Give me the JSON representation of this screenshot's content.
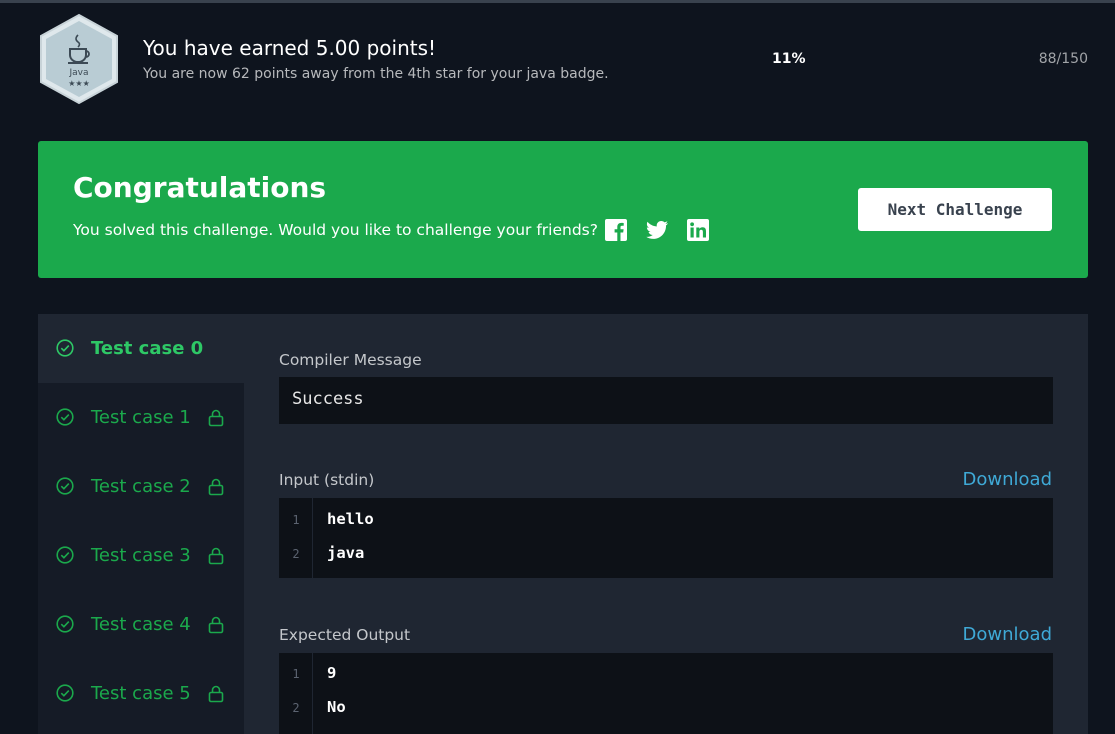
{
  "header": {
    "badge": {
      "label": "Java",
      "stars": "★★★",
      "icon": "java-cup-icon"
    },
    "title": "You have earned 5.00 points!",
    "subtitle": "You are now 62 points away from the 4th star for your java badge.",
    "progress_percent": "11%",
    "progress_count": "88/150"
  },
  "banner": {
    "title": "Congratulations",
    "text": "You solved this challenge. Would you like to challenge your friends?",
    "social_icons": [
      "facebook-icon",
      "twitter-icon",
      "linkedin-icon"
    ],
    "next_button": "Next Challenge",
    "color": "#1ba94c"
  },
  "tabs": [
    {
      "label": "Test case 0",
      "active": true,
      "locked": false
    },
    {
      "label": "Test case 1",
      "active": false,
      "locked": true
    },
    {
      "label": "Test case 2",
      "active": false,
      "locked": true
    },
    {
      "label": "Test case 3",
      "active": false,
      "locked": true
    },
    {
      "label": "Test case 4",
      "active": false,
      "locked": true
    },
    {
      "label": "Test case 5",
      "active": false,
      "locked": true
    }
  ],
  "compiler": {
    "label": "Compiler Message",
    "message": "Success"
  },
  "input": {
    "label": "Input (stdin)",
    "download": "Download",
    "lines": [
      {
        "n": "1",
        "text": "hello"
      },
      {
        "n": "2",
        "text": "java"
      }
    ]
  },
  "expected": {
    "label": "Expected Output",
    "download": "Download",
    "lines": [
      {
        "n": "1",
        "text": "9"
      },
      {
        "n": "2",
        "text": "No"
      }
    ]
  }
}
